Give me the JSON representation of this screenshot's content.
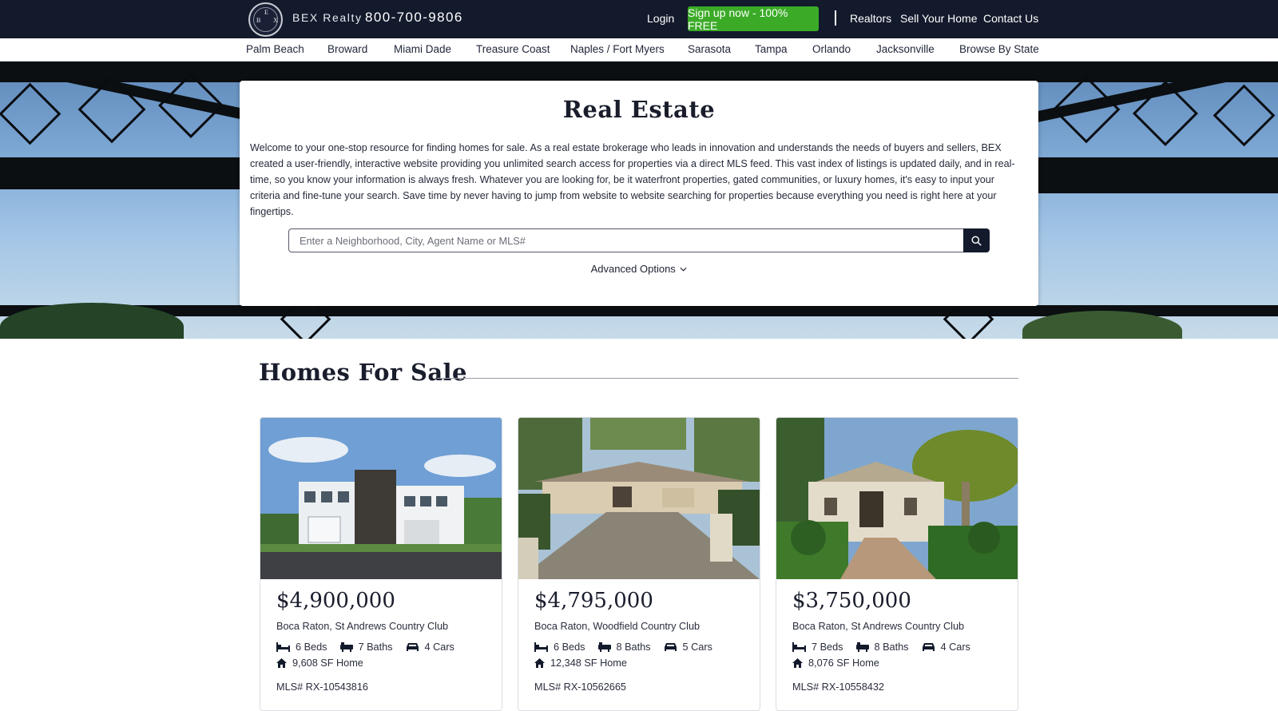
{
  "header": {
    "logo_letters": [
      "B",
      "E",
      "X"
    ],
    "brand": "BEX Realty",
    "phone": "800-700-9806",
    "login": "Login",
    "signup": "Sign up now - 100% FREE",
    "links": [
      "Realtors",
      "Sell Your Home",
      "Contact Us"
    ]
  },
  "location_nav": [
    "Palm Beach",
    "Broward",
    "Miami Dade",
    "Treasure Coast",
    "Naples / Fort Myers",
    "Sarasota",
    "Tampa",
    "Orlando",
    "Jacksonville",
    "Browse By State"
  ],
  "hero": {
    "title": "Real Estate",
    "intro": "Welcome to your one-stop resource for finding homes for sale. As a real estate brokerage who leads in innovation and understands the needs of buyers and sellers, BEX created a user-friendly, interactive website providing you unlimited search access for properties via a direct MLS feed. This vast index of listings is updated daily, and in real-time, so you know your information is always fresh. Whatever you are looking for, be it waterfront properties, gated communities, or luxury homes, it's easy to input your criteria and fine-tune your search. Save time by never having to jump from website to website searching for properties because everything you need is right here at your fingertips.",
    "search_placeholder": "Enter a Neighborhood, City, Agent Name or MLS#",
    "advanced": "Advanced Options"
  },
  "homes": {
    "title": "Homes For Sale",
    "listings": [
      {
        "price": "$4,900,000",
        "location": "Boca Raton, St Andrews Country Club",
        "beds": "6 Beds",
        "baths": "7 Baths",
        "cars": "4 Cars",
        "sqft": "9,608 SF Home",
        "mls": "MLS# RX-10543816"
      },
      {
        "price": "$4,795,000",
        "location": "Boca Raton, Woodfield Country Club",
        "beds": "6 Beds",
        "baths": "8 Baths",
        "cars": "5 Cars",
        "sqft": "12,348 SF Home",
        "mls": "MLS# RX-10562665"
      },
      {
        "price": "$3,750,000",
        "location": "Boca Raton, St Andrews Country Club",
        "beds": "7 Beds",
        "baths": "8 Baths",
        "cars": "4 Cars",
        "sqft": "8,076 SF Home",
        "mls": "MLS# RX-10558432"
      }
    ]
  },
  "colors": {
    "navy": "#131a2c",
    "signup_green": "#3bab27"
  },
  "icons": [
    "search-icon",
    "bed-icon",
    "bath-icon",
    "car-icon",
    "home-icon",
    "chevron-down-icon"
  ]
}
